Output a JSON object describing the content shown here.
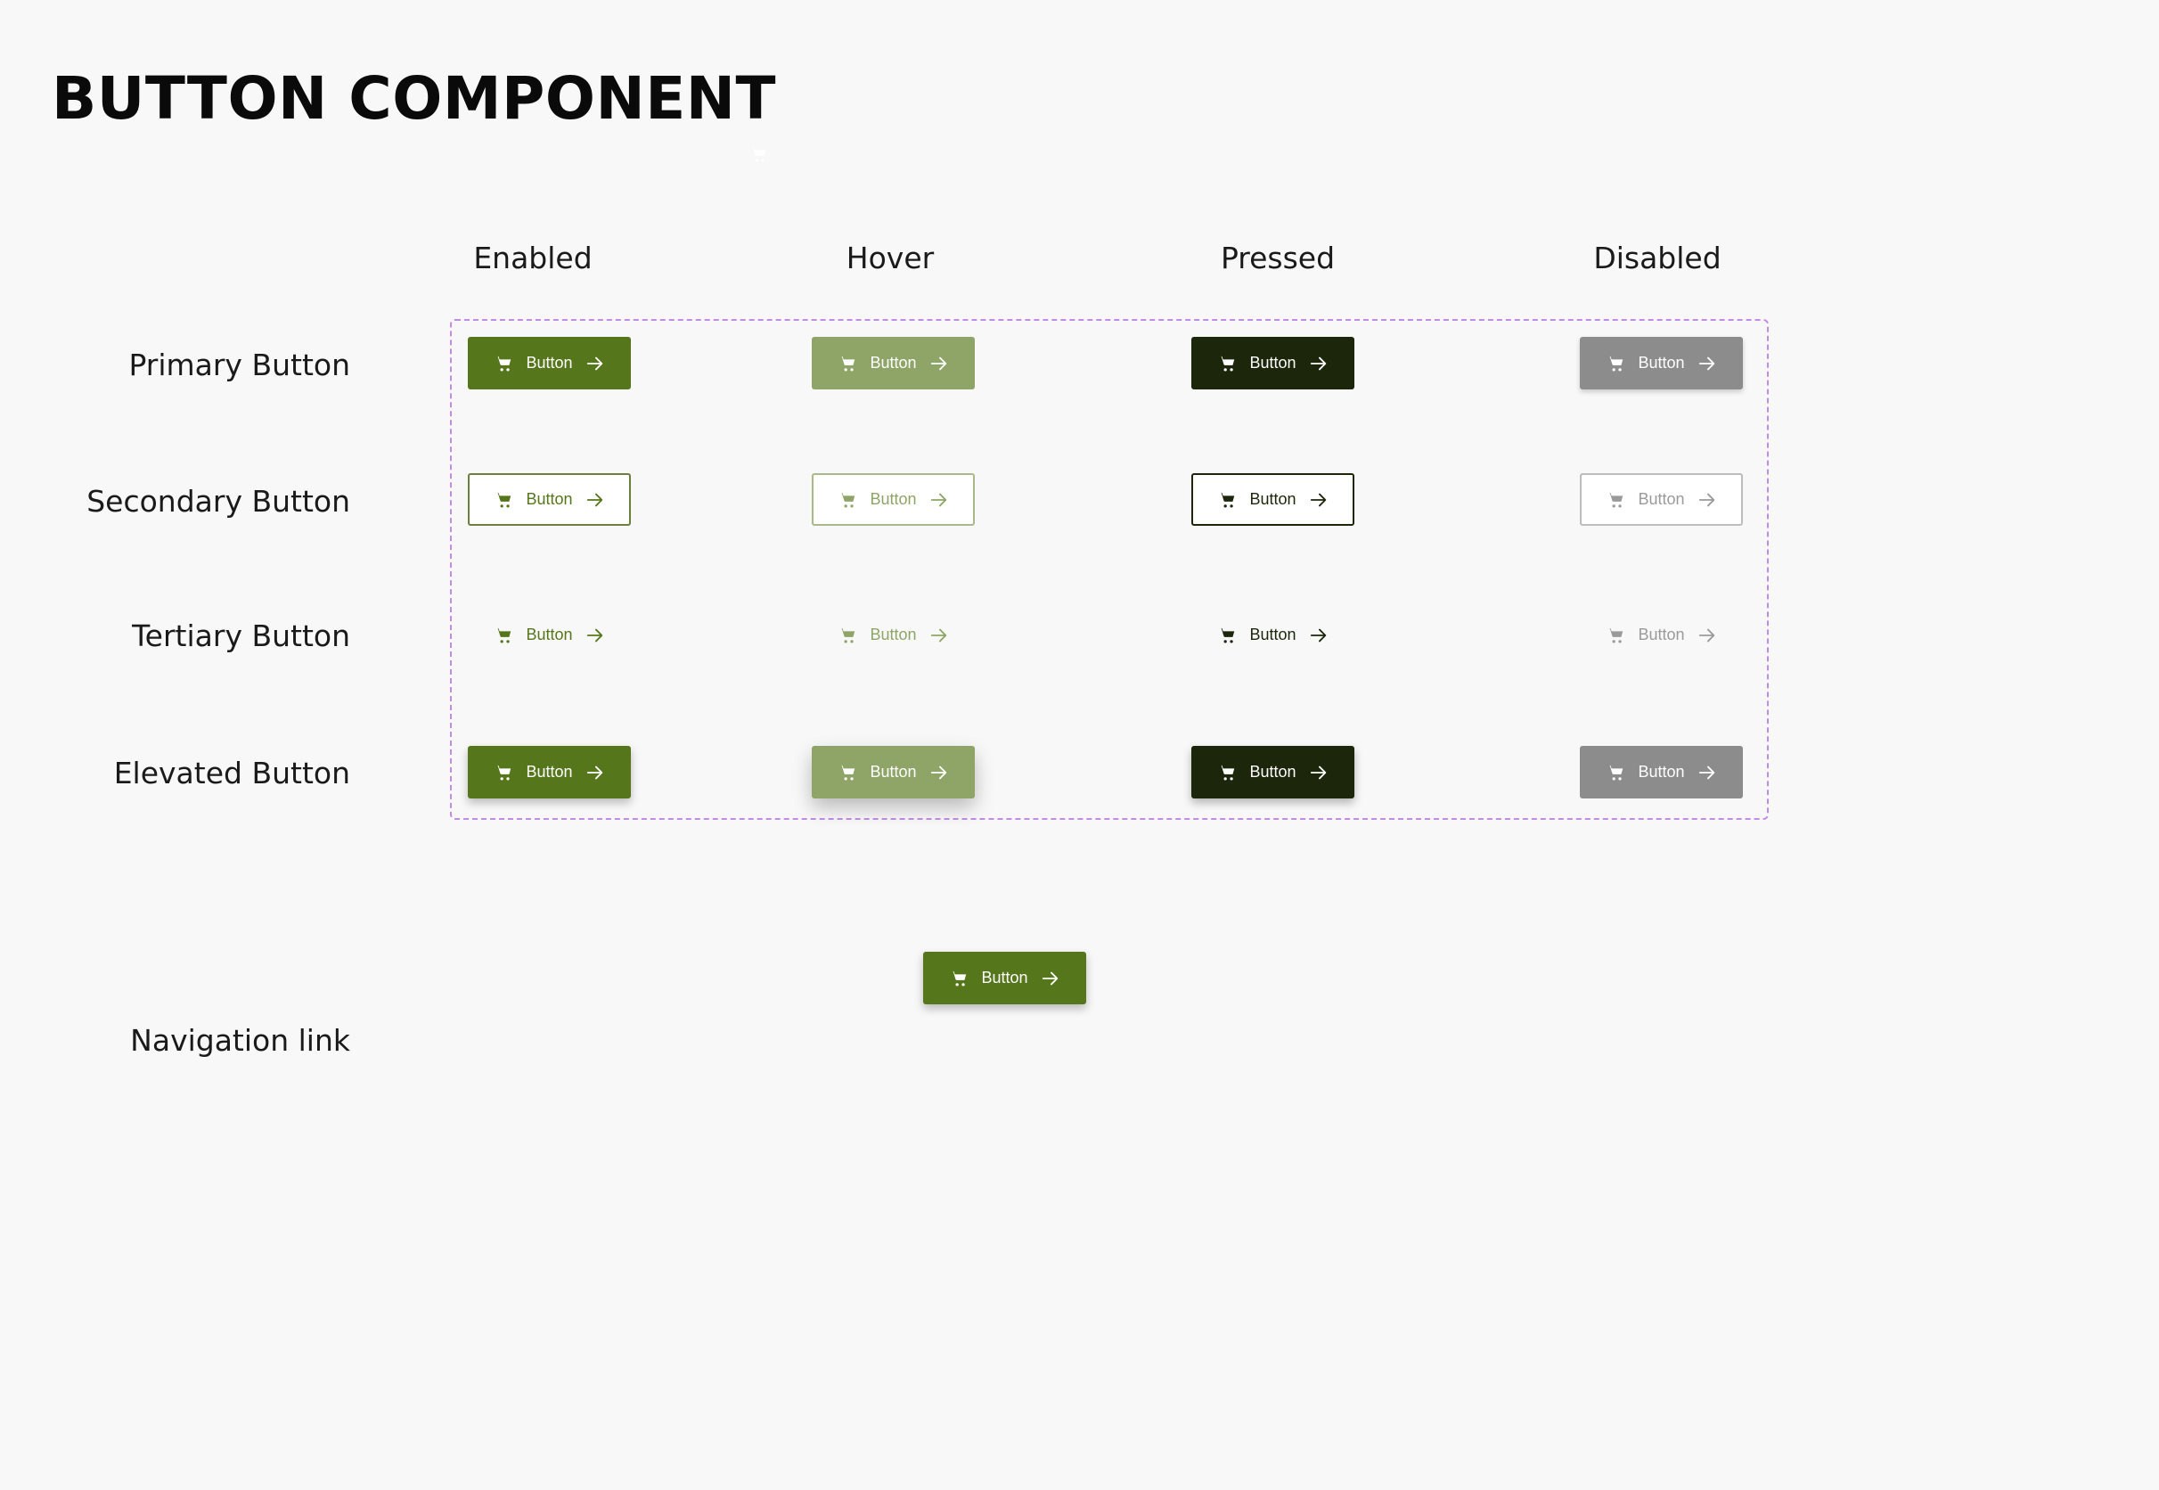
{
  "page": {
    "title": "BUTTON COMPONENT"
  },
  "columns": [
    {
      "label": "Enabled"
    },
    {
      "label": "Hover"
    },
    {
      "label": "Pressed"
    },
    {
      "label": "Disabled"
    }
  ],
  "rows": [
    {
      "label": "Primary Button"
    },
    {
      "label": "Secondary Button"
    },
    {
      "label": "Tertiary Button"
    },
    {
      "label": "Elevated Button"
    }
  ],
  "button": {
    "label": "Button",
    "leading_icon": "cart-icon",
    "trailing_icon": "arrow-right-icon"
  },
  "nav": {
    "label": "Navigation link",
    "button_label": "Button"
  },
  "colors": {
    "primary": "#56761c",
    "hover": "#8ea567",
    "pressed": "#1b260b",
    "disabled": "#8c8c8c",
    "frame_dash": "#c28ce6",
    "background": "#f8f8f8"
  }
}
